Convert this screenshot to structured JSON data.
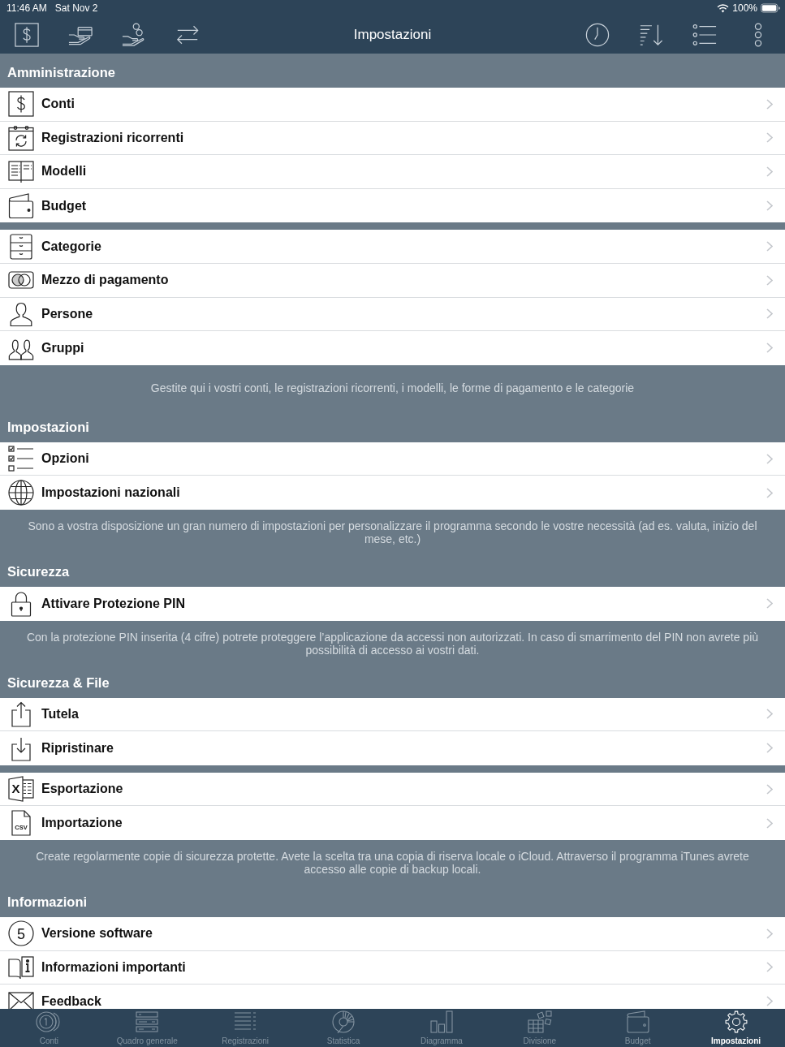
{
  "status_bar": {
    "time": "11:46 AM",
    "date": "Sat Nov 2",
    "battery": "100%"
  },
  "nav_bar": {
    "title": "Impostazioni"
  },
  "sections": [
    {
      "header": "Amministrazione",
      "groups": [
        {
          "items": [
            {
              "label": "Conti"
            },
            {
              "label": "Registrazioni ricorrenti"
            },
            {
              "label": "Modelli"
            },
            {
              "label": "Budget"
            }
          ]
        },
        {
          "items": [
            {
              "label": "Categorie"
            },
            {
              "label": "Mezzo di pagamento"
            },
            {
              "label": "Persone"
            },
            {
              "label": "Gruppi"
            }
          ]
        }
      ],
      "footer": "Gestite qui i vostri conti, le registrazioni ricorrenti, i modelli, le forme di pagamento e le categorie"
    },
    {
      "header": "Impostazioni",
      "groups": [
        {
          "items": [
            {
              "label": "Opzioni"
            },
            {
              "label": "Impostazioni nazionali"
            }
          ]
        }
      ],
      "footer": "Sono a vostra disposizione un gran numero di impostazioni per personalizzare il programma secondo le vostre necessità (ad es. valuta, inizio del mese, etc.)"
    },
    {
      "header": "Sicurezza",
      "groups": [
        {
          "items": [
            {
              "label": "Attivare Protezione PIN"
            }
          ]
        }
      ],
      "footer": "Con la protezione PIN inserita (4 cifre) potrete proteggere l’applicazione da accessi non autorizzati. In caso di smarrimento del PIN non avrete più possibilità di accesso ai vostri dati."
    },
    {
      "header": "Sicurezza & File",
      "groups": [
        {
          "items": [
            {
              "label": "Tutela"
            },
            {
              "label": "Ripristinare"
            }
          ]
        },
        {
          "items": [
            {
              "label": "Esportazione",
              "icon_text": "X"
            },
            {
              "label": "Importazione",
              "icon_text": "CSV"
            }
          ]
        }
      ],
      "footer": "Create regolarmente copie di sicurezza protette. Avete la scelta tra una copia di riserva locale o iCloud. Attraverso il programma iTunes avrete accesso alle copie di backup locali."
    },
    {
      "header": "Informazioni",
      "groups": [
        {
          "items": [
            {
              "label": "Versione software",
              "icon_text": "5"
            },
            {
              "label": "Informazioni importanti"
            },
            {
              "label": "Feedback"
            }
          ]
        }
      ]
    }
  ],
  "tab_bar": {
    "tabs": [
      {
        "label": "Conti",
        "selected": false
      },
      {
        "label": "Quadro generale",
        "selected": false
      },
      {
        "label": "Registrazioni",
        "selected": false
      },
      {
        "label": "Statistica",
        "selected": false
      },
      {
        "label": "Diagramma",
        "selected": false
      },
      {
        "label": "Divisione",
        "selected": false
      },
      {
        "label": "Budget",
        "selected": false
      },
      {
        "label": "Impostazioni",
        "selected": true
      }
    ]
  }
}
